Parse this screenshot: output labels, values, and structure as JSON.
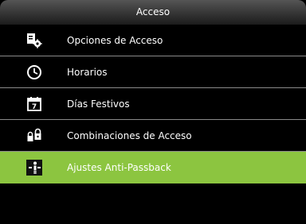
{
  "header": {
    "title": "Acceso"
  },
  "menu": {
    "items": [
      {
        "label": "Opciones de Acceso",
        "icon": "access-options-icon",
        "selected": false
      },
      {
        "label": "Horarios",
        "icon": "clock-icon",
        "selected": false
      },
      {
        "label": "Días Festivos",
        "icon": "calendar-icon",
        "selected": false
      },
      {
        "label": "Combinaciones de Acceso",
        "icon": "lock-combination-icon",
        "selected": false
      },
      {
        "label": "Ajustes Anti-Passback",
        "icon": "anti-passback-icon",
        "selected": true
      }
    ]
  },
  "colors": {
    "background": "#000000",
    "selected": "#8cc540",
    "divider": "#8a8a8a"
  }
}
